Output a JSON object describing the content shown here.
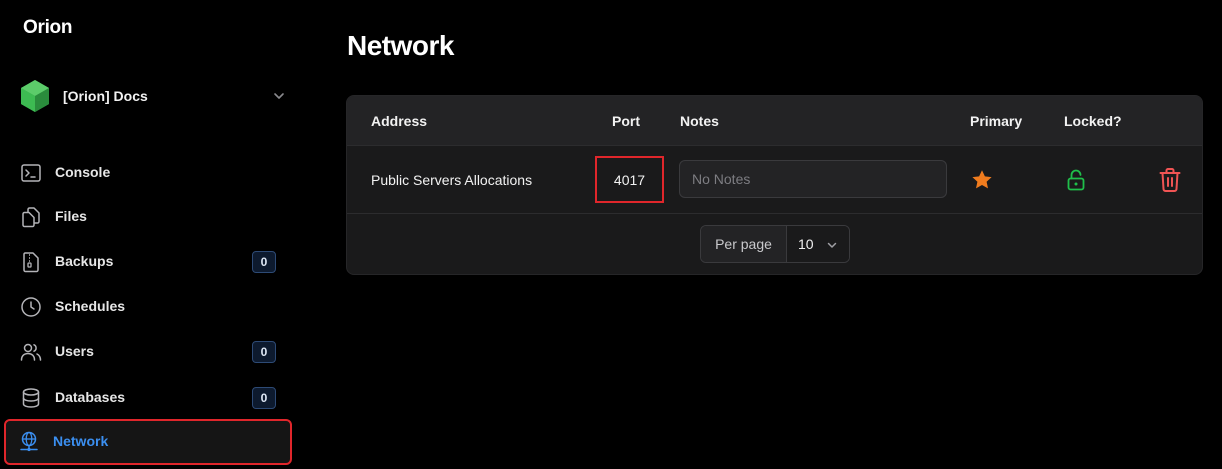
{
  "app": {
    "brand": "Orion"
  },
  "server": {
    "name": "[Orion] Docs",
    "logo_icon": "green-cube-icon"
  },
  "sidebar": {
    "items": [
      {
        "label": "Console",
        "icon": "terminal-icon"
      },
      {
        "label": "Files",
        "icon": "files-icon"
      },
      {
        "label": "Backups",
        "icon": "archive-icon",
        "badge": "0"
      },
      {
        "label": "Schedules",
        "icon": "clock-icon"
      },
      {
        "label": "Users",
        "icon": "users-icon",
        "badge": "0"
      },
      {
        "label": "Databases",
        "icon": "database-icon",
        "badge": "0"
      },
      {
        "label": "Network",
        "icon": "network-icon",
        "active": true
      }
    ]
  },
  "page": {
    "title": "Network"
  },
  "table": {
    "headers": {
      "address": "Address",
      "port": "Port",
      "notes": "Notes",
      "primary": "Primary",
      "locked": "Locked?"
    },
    "rows": [
      {
        "address": "Public Servers Allocations",
        "port": "4017",
        "notes_value": "",
        "notes_placeholder": "No Notes",
        "primary_icon": "star-icon",
        "locked_icon": "unlocked-icon",
        "delete_icon": "trash-icon"
      }
    ]
  },
  "pagination": {
    "label": "Per page",
    "value": "10"
  },
  "colors": {
    "accent_blue": "#3b8ff0",
    "primary_star": "#f07c1e",
    "lock_green": "#1fbf4a",
    "delete_red": "#f05454",
    "highlight_red": "#e0262b"
  }
}
